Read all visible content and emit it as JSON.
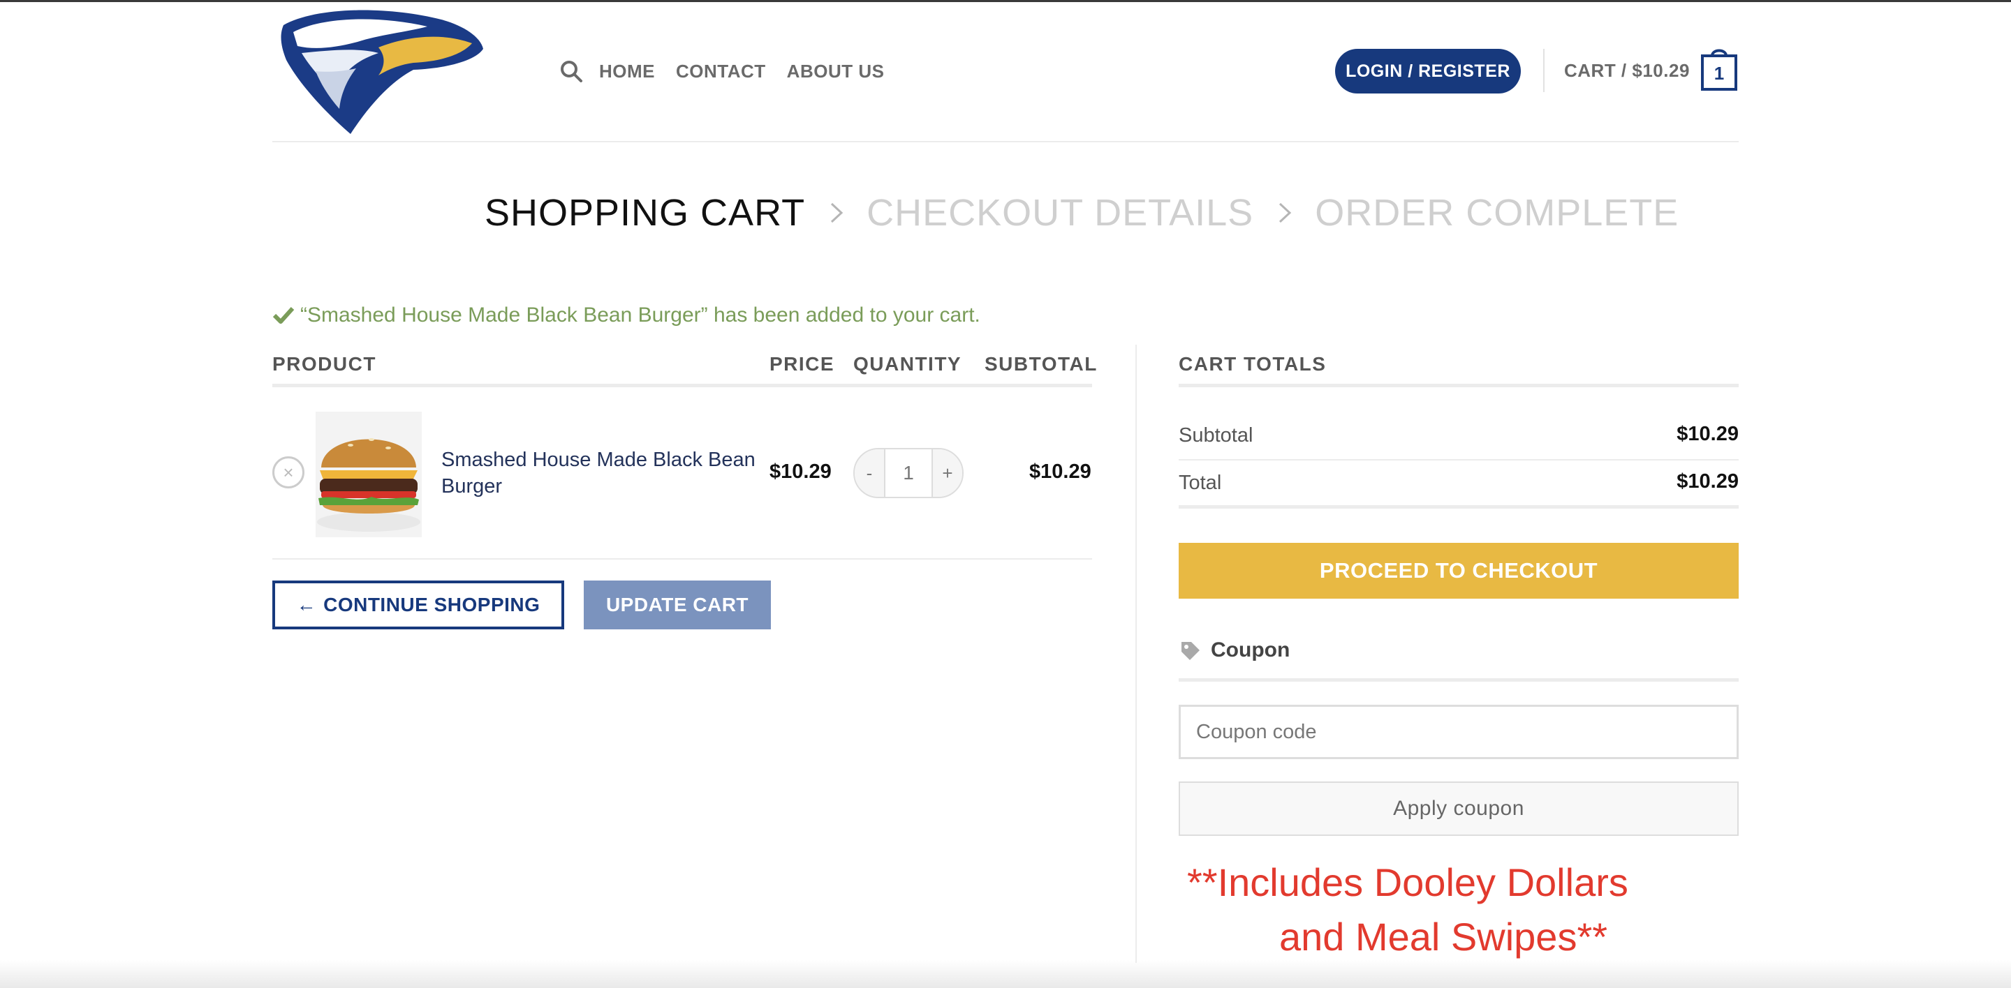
{
  "header": {
    "logo_icon": "eagle-logo-icon",
    "nav": {
      "search_icon": "search-icon",
      "items": [
        "HOME",
        "CONTACT",
        "ABOUT US"
      ]
    },
    "login_label": "LOGIN / REGISTER",
    "cart_label": "CART / $10.29",
    "cart_count": "1"
  },
  "steps": {
    "items": [
      "SHOPPING CART",
      "CHECKOUT DETAILS",
      "ORDER COMPLETE"
    ],
    "active_index": 0
  },
  "notice": {
    "text": "“Smashed House Made Black Bean Burger” has been added to your cart."
  },
  "cart": {
    "columns": [
      "PRODUCT",
      "PRICE",
      "QUANTITY",
      "SUBTOTAL"
    ],
    "rows": [
      {
        "name": "Smashed House Made Black Bean Burger",
        "price": "$10.29",
        "quantity": "1",
        "subtotal": "$10.29"
      }
    ],
    "qty_minus": "-",
    "qty_plus": "+",
    "remove_symbol": "×",
    "continue_label": "CONTINUE SHOPPING",
    "continue_arrow": "←",
    "update_label": "UPDATE CART"
  },
  "totals": {
    "heading": "CART TOTALS",
    "subtotal_label": "Subtotal",
    "subtotal_value": "$10.29",
    "total_label": "Total",
    "total_value": "$10.29",
    "checkout_label": "PROCEED TO CHECKOUT",
    "coupon_heading": "Coupon",
    "coupon_placeholder": "Coupon code",
    "apply_label": "Apply coupon"
  },
  "promo": {
    "line1": "**Includes Dooley Dollars",
    "line2": "and Meal Swipes**"
  },
  "colors": {
    "brand_navy": "#17397d",
    "checkout_gold": "#e8b943",
    "update_blue": "#7b93be",
    "notice_green": "#7a9c59",
    "promo_red": "#e23a2e"
  }
}
